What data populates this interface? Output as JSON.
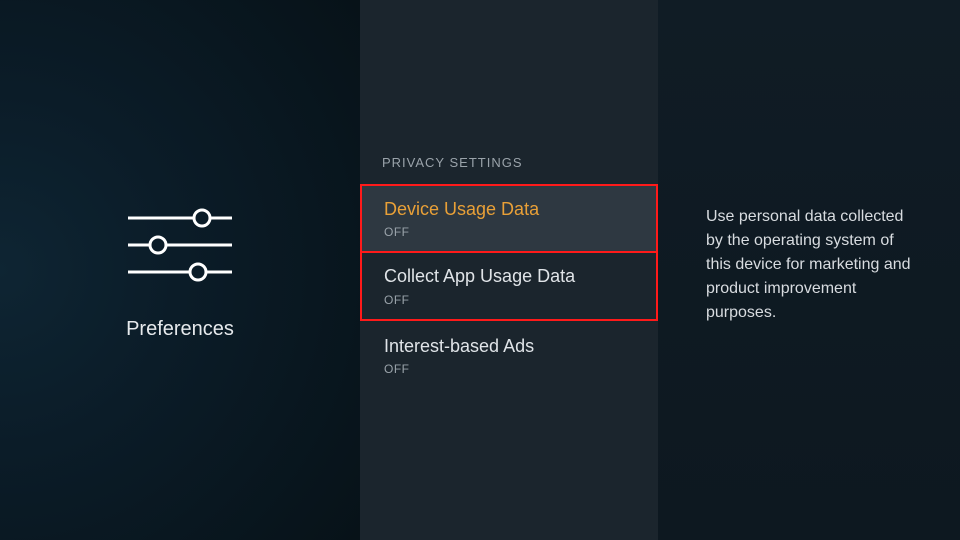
{
  "left": {
    "label": "Preferences",
    "icon": "sliders"
  },
  "section_title": "PRIVACY SETTINGS",
  "items": [
    {
      "title": "Device Usage Data",
      "status": "OFF",
      "selected": true,
      "highlighted": true
    },
    {
      "title": "Collect App Usage Data",
      "status": "OFF",
      "selected": false,
      "highlighted": true
    },
    {
      "title": "Interest-based Ads",
      "status": "OFF",
      "selected": false,
      "highlighted": false
    }
  ],
  "description": "Use personal data collected by the operating system of this device for marketing and product improvement purposes."
}
